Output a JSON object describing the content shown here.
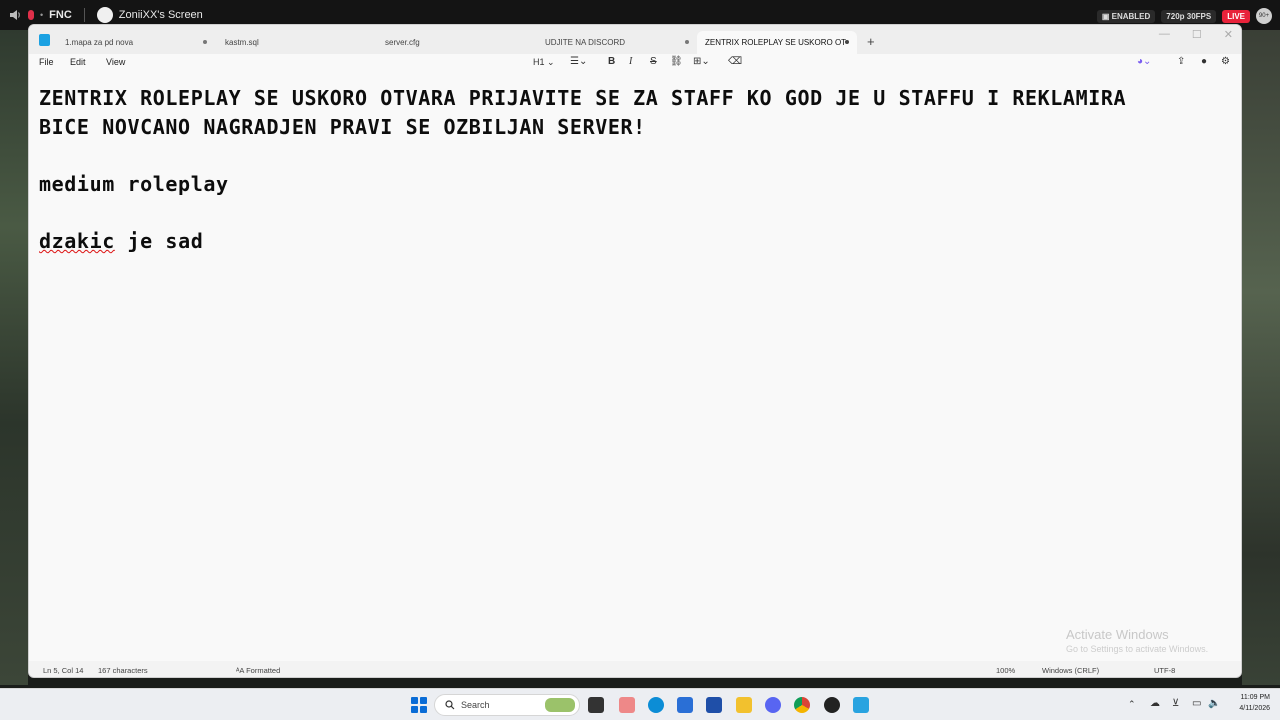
{
  "overlay": {
    "channel": "FNC",
    "screen_title": "ZoniiXX's Screen",
    "enabled_label": "ENABLED",
    "quality_label": "720p 30FPS",
    "live_label": "LIVE",
    "viewer_count": "90+"
  },
  "notepad": {
    "tabs": [
      {
        "label": "1.mapa za pd nova",
        "modified": true
      },
      {
        "label": "kastm.sql",
        "modified": false
      },
      {
        "label": "server.cfg",
        "modified": false
      },
      {
        "label": "UDJITE NA DISCORD",
        "modified": true
      },
      {
        "label": "ZENTRIX ROLEPLAY SE USKORO OT",
        "modified": true,
        "active": true
      }
    ],
    "add_tab_label": "+",
    "menu": {
      "file": "File",
      "edit": "Edit",
      "view": "View"
    },
    "toolbar": {
      "heading": "H1",
      "list_icon": "list-icon",
      "bold": "B",
      "italic": "I",
      "strikethrough": "S",
      "link_icon": "link-icon",
      "table_icon": "table-icon",
      "clear_format_icon": "clear-formatting-icon"
    },
    "content": {
      "line1": "ZENTRIX ROLEPLAY SE USKORO OTVARA PRIJAVITE SE ZA STAFF KO GOD JE U STAFFU I REKLAMIRA",
      "line2": "BICE NOVCANO NAGRADJEN PRAVI SE OZBILJAN SERVER!",
      "line3": "medium roleplay",
      "line4_word1": "dzakic",
      "line4_rest": " je sad"
    },
    "watermark": {
      "title": "Activate Windows",
      "subtitle": "Go to Settings to activate Windows."
    },
    "status": {
      "position": "Ln 5, Col 14",
      "characters": "167 characters",
      "format": "Formatted",
      "zoom": "100%",
      "line_ending": "Windows (CRLF)",
      "encoding": "UTF-8"
    }
  },
  "taskbar": {
    "search_placeholder": "Search",
    "time": "11:09 PM",
    "date": "4/11/2026"
  }
}
